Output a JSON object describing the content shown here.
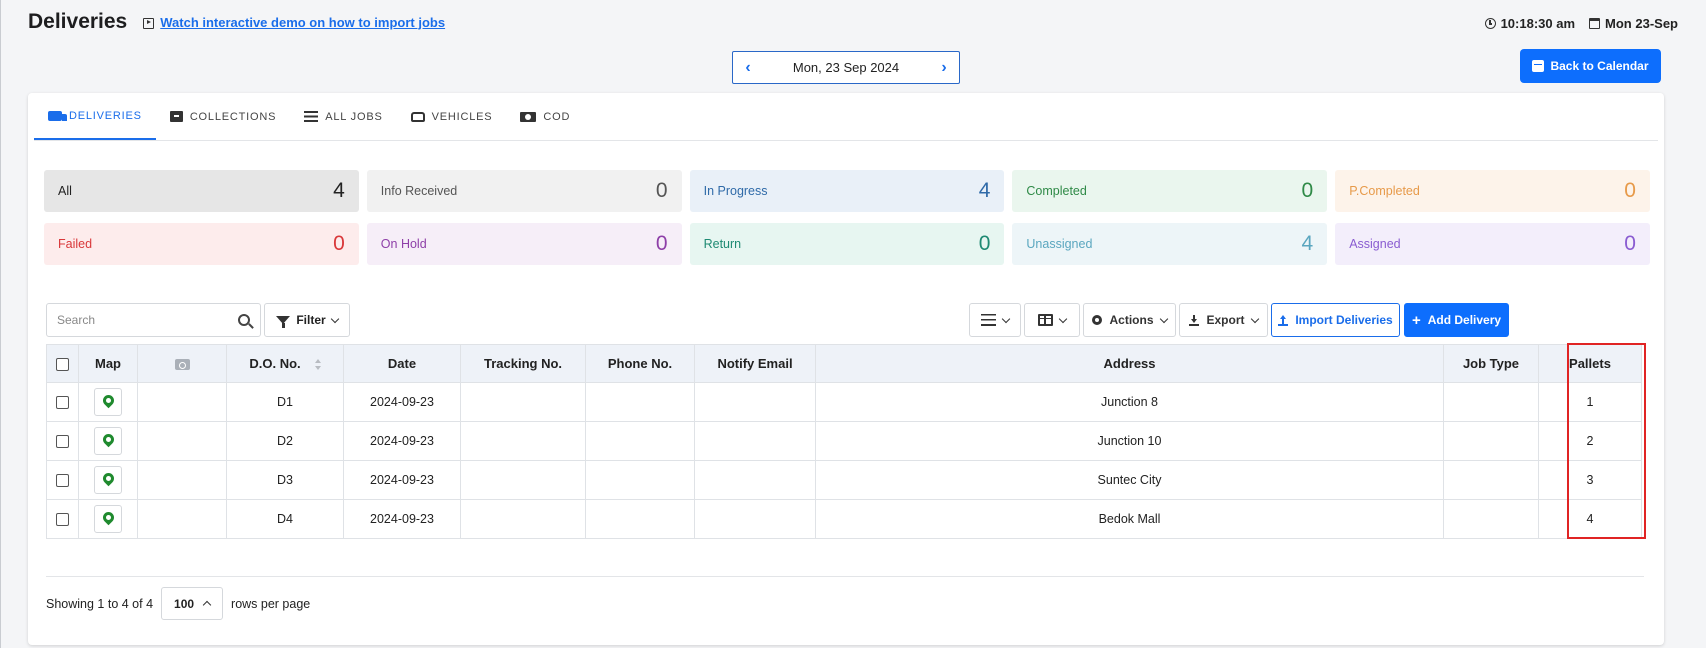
{
  "header": {
    "title": "Deliveries",
    "demo_link": "Watch interactive demo on how to import jobs",
    "time": "10:18:30 am",
    "date": "Mon 23-Sep"
  },
  "date_nav": {
    "date": "Mon, 23 Sep 2024",
    "prev": "‹",
    "next": "›"
  },
  "back_to_calendar": "Back to Calendar",
  "tabs": [
    {
      "label": "DELIVERIES",
      "icon": "truck-icon",
      "active": true
    },
    {
      "label": "COLLECTIONS",
      "icon": "box-icon"
    },
    {
      "label": "ALL JOBS",
      "icon": "list-icon"
    },
    {
      "label": "VEHICLES",
      "icon": "car-icon"
    },
    {
      "label": "COD",
      "icon": "cash-icon"
    }
  ],
  "stats": [
    {
      "label": "All",
      "value": "4",
      "bg": "#e6e6e6",
      "color": "#222222"
    },
    {
      "label": "Info Received",
      "value": "0",
      "bg": "#f1f1f1",
      "color": "#555555"
    },
    {
      "label": "In Progress",
      "value": "4",
      "bg": "#e9f0f8",
      "color": "#2f6aa8"
    },
    {
      "label": "Completed",
      "value": "0",
      "bg": "#eaf6ee",
      "color": "#2f8a47"
    },
    {
      "label": "P.Completed",
      "value": "0",
      "bg": "#fdf3ea",
      "color": "#e79a4a"
    },
    {
      "label": "Failed",
      "value": "0",
      "bg": "#fdecec",
      "color": "#d9383a"
    },
    {
      "label": "On Hold",
      "value": "0",
      "bg": "#f6eef8",
      "color": "#8e3fa8"
    },
    {
      "label": "Return",
      "value": "0",
      "bg": "#e7f6f1",
      "color": "#1f8a73"
    },
    {
      "label": "Unassigned",
      "value": "4",
      "bg": "#edf5f8",
      "color": "#5aa6bf"
    },
    {
      "label": "Assigned",
      "value": "0",
      "bg": "#f3eefb",
      "color": "#8a5cd1"
    }
  ],
  "toolbar": {
    "search_placeholder": "Search",
    "filter_label": "Filter",
    "actions_label": "Actions",
    "export_label": "Export",
    "import_label": "Import Deliveries",
    "add_label": "Add Delivery"
  },
  "table": {
    "columns": [
      "Map",
      "D.O. No.",
      "Date",
      "Tracking No.",
      "Phone No.",
      "Notify Email",
      "Address",
      "Job Type",
      "Pallets"
    ],
    "rows": [
      {
        "do_no": "D1",
        "date": "2024-09-23",
        "tracking": "",
        "phone": "",
        "email": "",
        "address": "Junction 8",
        "job_type": "",
        "pallets": "1"
      },
      {
        "do_no": "D2",
        "date": "2024-09-23",
        "tracking": "",
        "phone": "",
        "email": "",
        "address": "Junction 10",
        "job_type": "",
        "pallets": "2"
      },
      {
        "do_no": "D3",
        "date": "2024-09-23",
        "tracking": "",
        "phone": "",
        "email": "",
        "address": "Suntec City",
        "job_type": "",
        "pallets": "3"
      },
      {
        "do_no": "D4",
        "date": "2024-09-23",
        "tracking": "",
        "phone": "",
        "email": "",
        "address": "Bedok Mall",
        "job_type": "",
        "pallets": "4"
      }
    ]
  },
  "footer": {
    "showing": "Showing 1 to 4 of 4",
    "rows_per_page_value": "100",
    "rows_per_page_label": "rows per page"
  }
}
